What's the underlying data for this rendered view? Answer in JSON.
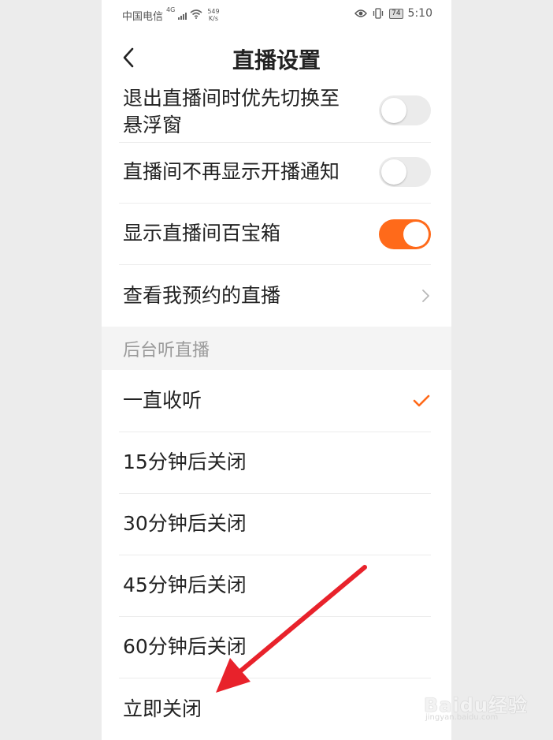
{
  "status_bar": {
    "carrier": "中国电信",
    "network_type": "4G",
    "net_speed_value": "549",
    "net_speed_unit": "K/s",
    "battery": "74",
    "time": "5:10"
  },
  "header": {
    "title": "直播设置"
  },
  "settings": [
    {
      "label_line1": "退出直播间时优先切换至",
      "label_line2": "悬浮窗",
      "toggle_on": false
    },
    {
      "label": "直播间不再显示开播通知",
      "toggle_on": false
    },
    {
      "label": "显示直播间百宝箱",
      "toggle_on": true
    },
    {
      "label": "查看我预约的直播"
    }
  ],
  "background_listen": {
    "section_title": "后台听直播",
    "options": [
      {
        "label": "一直收听",
        "selected": true
      },
      {
        "label": "15分钟后关闭",
        "selected": false
      },
      {
        "label": "30分钟后关闭",
        "selected": false
      },
      {
        "label": "45分钟后关闭",
        "selected": false
      },
      {
        "label": "60分钟后关闭",
        "selected": false
      },
      {
        "label": "立即关闭",
        "selected": false
      }
    ]
  },
  "colors": {
    "accent": "#ff6a1a",
    "arrow": "#e8222b"
  },
  "watermark": {
    "text": "Baidu经验",
    "sub": "jingyan.baidu.com"
  }
}
